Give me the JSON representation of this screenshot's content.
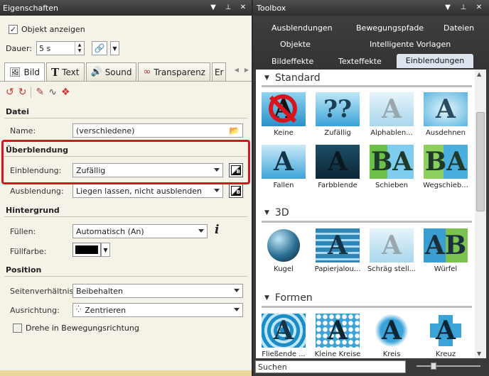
{
  "left_panel": {
    "title": "Eigenschaften",
    "controls": [
      "▼",
      "⊥",
      "✕"
    ],
    "show_object_label": "Objekt anzeigen",
    "duration_label": "Dauer:",
    "duration_value": "5 s",
    "tabs": [
      {
        "label": "Bild",
        "icon": "image-icon"
      },
      {
        "label": "Text",
        "icon": "text-icon"
      },
      {
        "label": "Sound",
        "icon": "sound-icon"
      },
      {
        "label": "Transparenz",
        "icon": "transparency-icon"
      },
      {
        "label": "Er"
      }
    ],
    "sections": {
      "datei": {
        "title": "Datei",
        "name_label": "Name:",
        "name_value": "(verschiedene)"
      },
      "ueberblendung": {
        "title": "Überblendung",
        "einblendung_label": "Einblendung:",
        "einblendung_value": "Zufällig",
        "ausblendung_label": "Ausblendung:",
        "ausblendung_value": "Liegen lassen, nicht ausblenden"
      },
      "hintergrund": {
        "title": "Hintergrund",
        "fuellen_label": "Füllen:",
        "fuellen_value": "Automatisch (An)",
        "fuellfarbe_label": "Füllfarbe:",
        "fuellfarbe_color": "#000000"
      },
      "position": {
        "title": "Position",
        "seitenverhaeltnis_label": "Seitenverhältnis:",
        "seitenverhaeltnis_value": "Beibehalten",
        "ausrichtung_label": "Ausrichtung:",
        "ausrichtung_value": "Zentrieren",
        "drehe_label": "Drehe in Bewegungsrichtung"
      }
    },
    "highlight_color": "#d8141c"
  },
  "right_panel": {
    "title": "Toolbox",
    "controls": [
      "▼",
      "⊥",
      "✕"
    ],
    "tabs_row1": [
      "Ausblendungen",
      "Bewegungspfade",
      "Dateien"
    ],
    "tabs_row2": [
      "Objekte",
      "Intelligente Vorlagen"
    ],
    "tabs_row3": [
      "Bildeffekte",
      "Texteffekte",
      "Einblendungen"
    ],
    "active_tab": "Einblendungen",
    "categories": [
      {
        "title": "Standard",
        "items": [
          [
            "Keine",
            "Zufällig",
            "Alphablen...",
            "Ausdehnen"
          ],
          [
            "Fallen",
            "Farbblende",
            "Schieben",
            "Wegschieb..."
          ]
        ]
      },
      {
        "title": "3D",
        "items": [
          [
            "Kugel",
            "Papierjalou...",
            "Schräg stell...",
            "Würfel"
          ]
        ]
      },
      {
        "title": "Formen",
        "items": [
          [
            "Fließende ...",
            "Kleine Kreise",
            "Kreis",
            "Kreuz"
          ]
        ]
      }
    ],
    "search_placeholder": "Suchen"
  }
}
